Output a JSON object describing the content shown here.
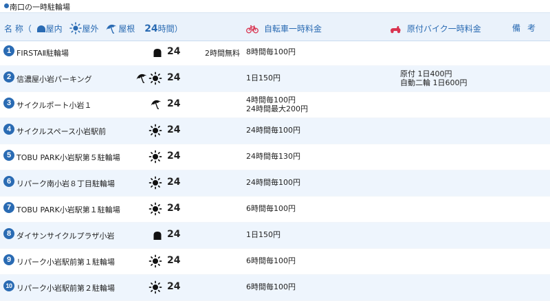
{
  "section_title": "南口の一時駐輪場",
  "header": {
    "name_label": "名 称（",
    "indoor_label": "屋内",
    "outdoor_label": "屋外",
    "roof_label": "屋根",
    "hours_label": "24",
    "hours_suffix": "時間）",
    "bicycle_fee_label": "自転車一時料金",
    "moped_fee_label": "原付バイク一時料金",
    "notes_label": "備考"
  },
  "colors": {
    "accent": "#2a6bb3",
    "row_alt": "#eef5fd",
    "header_bg": "#eaf2fb",
    "moped_icon": "#d9334f"
  },
  "rows": [
    {
      "num": "1",
      "name": "FIRSTAⅡ駐輪場",
      "icons": [
        "indoor"
      ],
      "hours": "24",
      "free": "2時間無料",
      "price": [
        "8時間毎100円"
      ],
      "note": []
    },
    {
      "num": "2",
      "name": "信濃屋小岩パーキング",
      "icons": [
        "roof",
        "outdoor"
      ],
      "hours": "24",
      "free": "",
      "price": [
        "1日150円"
      ],
      "note": [
        "原付 1日400円",
        "自動二輪 1日600円"
      ]
    },
    {
      "num": "3",
      "name": "サイクルポート小岩１",
      "icons": [
        "roof"
      ],
      "hours": "24",
      "free": "",
      "price": [
        "4時間毎100円",
        "24時間最大200円"
      ],
      "note": []
    },
    {
      "num": "4",
      "name": "サイクルスペース小岩駅前",
      "icons": [
        "outdoor"
      ],
      "hours": "24",
      "free": "",
      "price": [
        "24時間毎100円"
      ],
      "note": []
    },
    {
      "num": "5",
      "name": "TOBU PARK小岩駅第５駐輪場",
      "icons": [
        "outdoor"
      ],
      "hours": "24",
      "free": "",
      "price": [
        "24時間毎130円"
      ],
      "note": []
    },
    {
      "num": "6",
      "name": "リパーク南小岩８丁目駐輪場",
      "icons": [
        "outdoor"
      ],
      "hours": "24",
      "free": "",
      "price": [
        "24時間毎100円"
      ],
      "note": []
    },
    {
      "num": "7",
      "name": "TOBU PARK小岩駅第１駐輪場",
      "icons": [
        "outdoor"
      ],
      "hours": "24",
      "free": "",
      "price": [
        "6時間毎100円"
      ],
      "note": []
    },
    {
      "num": "8",
      "name": "ダイサンサイクルプラザ小岩",
      "icons": [
        "indoor"
      ],
      "hours": "24",
      "free": "",
      "price": [
        "1日150円"
      ],
      "note": []
    },
    {
      "num": "9",
      "name": "リパーク小岩駅前第１駐輪場",
      "icons": [
        "outdoor"
      ],
      "hours": "24",
      "free": "",
      "price": [
        "6時間毎100円"
      ],
      "note": []
    },
    {
      "num": "10",
      "name": "リパーク小岩駅前第２駐輪場",
      "icons": [
        "outdoor"
      ],
      "hours": "24",
      "free": "",
      "price": [
        "6時間毎100円"
      ],
      "note": []
    }
  ]
}
